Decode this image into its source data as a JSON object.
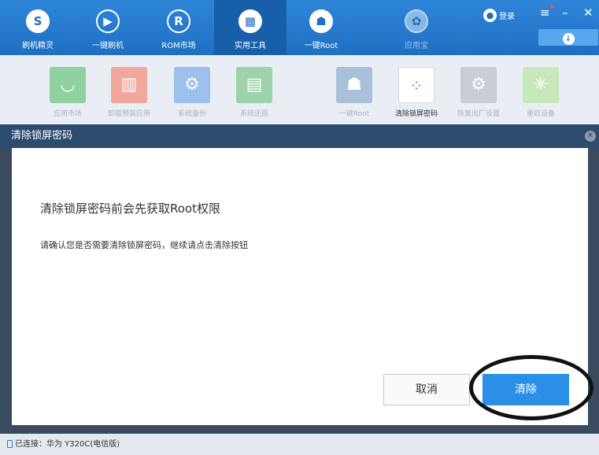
{
  "nav": [
    {
      "label": "刷机精灵",
      "icon": "shield-icon",
      "glyph": "S"
    },
    {
      "label": "一键刷机",
      "icon": "play-icon",
      "glyph": "▶"
    },
    {
      "label": "ROM市场",
      "icon": "rom-icon",
      "glyph": "R"
    },
    {
      "label": "实用工具",
      "icon": "grid-icon",
      "glyph": "▦"
    },
    {
      "label": "一键Root",
      "icon": "android-icon",
      "glyph": "☗"
    },
    {
      "label": "应用宝",
      "icon": "app-store-icon",
      "glyph": "✿"
    }
  ],
  "header": {
    "login_label": "登录"
  },
  "tools": [
    {
      "label": "应用市场",
      "color": "#8fd2a0",
      "glyph": "◡"
    },
    {
      "label": "卸载预装应用",
      "color": "#f2a79d",
      "glyph": "▥"
    },
    {
      "label": "系统备份",
      "color": "#9cc0ec",
      "glyph": "⚙"
    },
    {
      "label": "系统还原",
      "color": "#9dd2aa",
      "glyph": "▤"
    },
    {
      "label": "一键Root",
      "color": "#a8c0d8",
      "glyph": "☗"
    },
    {
      "label": "清除锁屏密码",
      "color": "#ffffff",
      "glyph": "⁘"
    },
    {
      "label": "恢复出厂设置",
      "color": "#c7ced6",
      "glyph": "⚙"
    },
    {
      "label": "重启设备",
      "color": "#c7e9b9",
      "glyph": "✳"
    }
  ],
  "modal": {
    "header": "清除锁屏密码",
    "title": "清除锁屏密码前会先获取Root权限",
    "desc": "请确认您是否需要清除锁屏密码，继续请点击清除按钮",
    "cancel_label": "取消",
    "clear_label": "清除"
  },
  "status": {
    "text": "已连接：华为 Y320C(电信版)"
  }
}
